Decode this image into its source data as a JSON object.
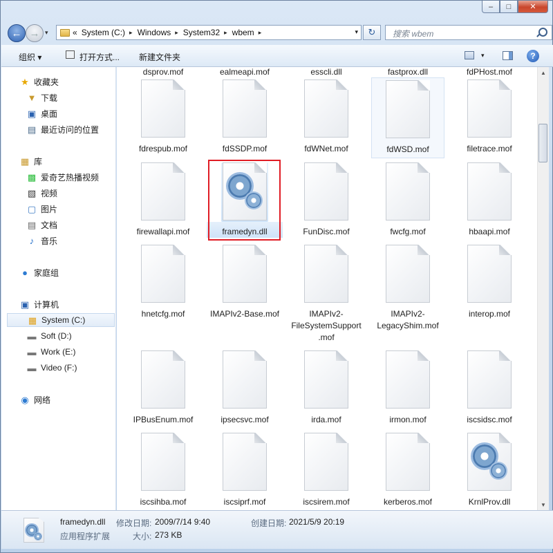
{
  "window": {
    "minimize": "–",
    "maximize": "□",
    "close": "✕"
  },
  "address": {
    "overflow": "«",
    "crumbs": [
      "System (C:)",
      "Windows",
      "System32",
      "wbem"
    ],
    "sep": "▸",
    "dropdown": "▾"
  },
  "search": {
    "placeholder": "搜索 wbem"
  },
  "toolbar": {
    "organize": "组织 ▾",
    "open_with": "打开方式...",
    "new_folder": "新建文件夹",
    "view_drop": "▾",
    "help": "?"
  },
  "sidebar": {
    "favorites": "收藏夹",
    "downloads": "下载",
    "desktop": "桌面",
    "recent": "最近访问的位置",
    "libraries": "库",
    "iqiyi": "爱奇艺热播视频",
    "videos": "视频",
    "pictures": "图片",
    "documents": "文档",
    "music": "音乐",
    "homegroup": "家庭组",
    "computer": "计算机",
    "drive_c": "System (C:)",
    "drive_d": "Soft (D:)",
    "drive_e": "Work (E:)",
    "drive_f": "Video (F:)",
    "network": "网络"
  },
  "files": {
    "partial": [
      "dsprov.mof",
      "ealmeapi.mof",
      "esscli.dll",
      "fastprox.dll",
      "fdPHost.mof"
    ],
    "row1": [
      "fdrespub.mof",
      "fdSSDP.mof",
      "fdWNet.mof",
      "fdWSD.mof",
      "filetrace.mof"
    ],
    "row2": [
      "firewallapi.mof",
      "framedyn.dll",
      "FunDisc.mof",
      "fwcfg.mof",
      "hbaapi.mof"
    ],
    "row3": [
      "hnetcfg.mof",
      "IMAPIv2-Base.mof",
      "IMAPIv2-FileSystemSupport.mof",
      "IMAPIv2-LegacyShim.mof",
      "interop.mof"
    ],
    "row4": [
      "IPBusEnum.mof",
      "ipsecsvc.mof",
      "irda.mof",
      "irmon.mof",
      "iscsidsc.mof"
    ],
    "row5": [
      "iscsihba.mof",
      "iscsiprf.mof",
      "iscsirem.mof",
      "kerberos.mof",
      "KrnlProv.dll"
    ]
  },
  "details": {
    "name": "framedyn.dll",
    "modified_label": "修改日期:",
    "modified": "2009/7/14 9:40",
    "created_label": "创建日期:",
    "created": "2021/5/9 20:19",
    "type": "应用程序扩展",
    "size_label": "大小:",
    "size": "273 KB"
  }
}
